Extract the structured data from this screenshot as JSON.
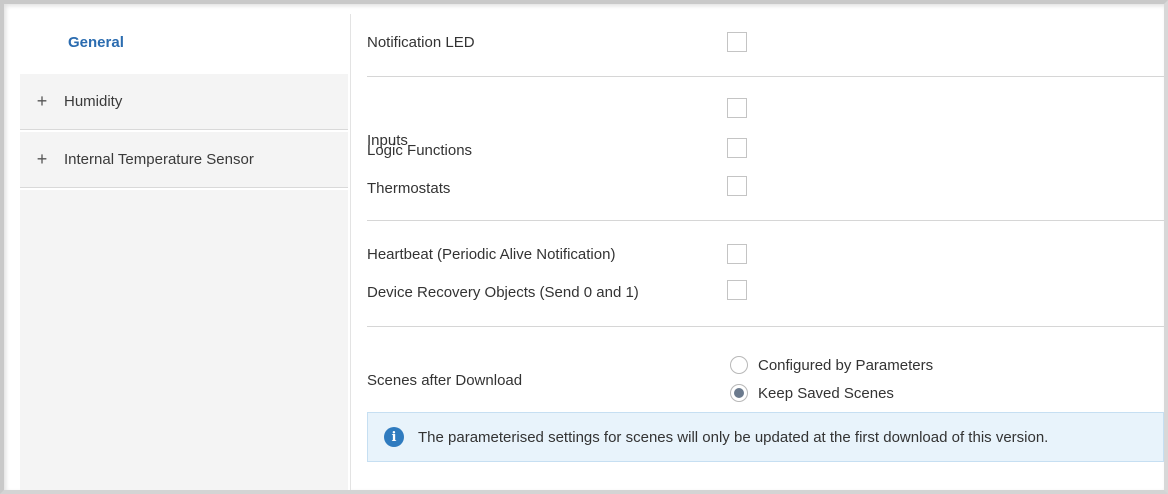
{
  "sidebar": {
    "items": [
      {
        "label": "General",
        "expander": ""
      },
      {
        "label": "Humidity",
        "expander": "+"
      },
      {
        "label": "Internal Temperature Sensor",
        "expander": "+"
      }
    ]
  },
  "main": {
    "notification_led": {
      "label": "Notification LED",
      "checked": false
    },
    "inputs": {
      "label": "Inputs",
      "checked": false
    },
    "logic_functions": {
      "label": "Logic Functions",
      "checked": false
    },
    "thermostats": {
      "label": "Thermostats",
      "checked": false
    },
    "heartbeat": {
      "label": "Heartbeat (Periodic Alive Notification)",
      "checked": false
    },
    "device_recovery": {
      "label": "Device Recovery Objects (Send 0 and 1)",
      "checked": false
    },
    "scenes": {
      "label": "Scenes after Download",
      "options": [
        "Configured by Parameters",
        "Keep Saved Scenes"
      ],
      "selected": "Keep Saved Scenes"
    },
    "info_message": "The parameterised settings for scenes will only be updated at the first download of this version."
  },
  "colors": {
    "accent": "#2b6cb0",
    "info_bg": "#e8f3fb",
    "info_icon": "#2f7bbf"
  }
}
